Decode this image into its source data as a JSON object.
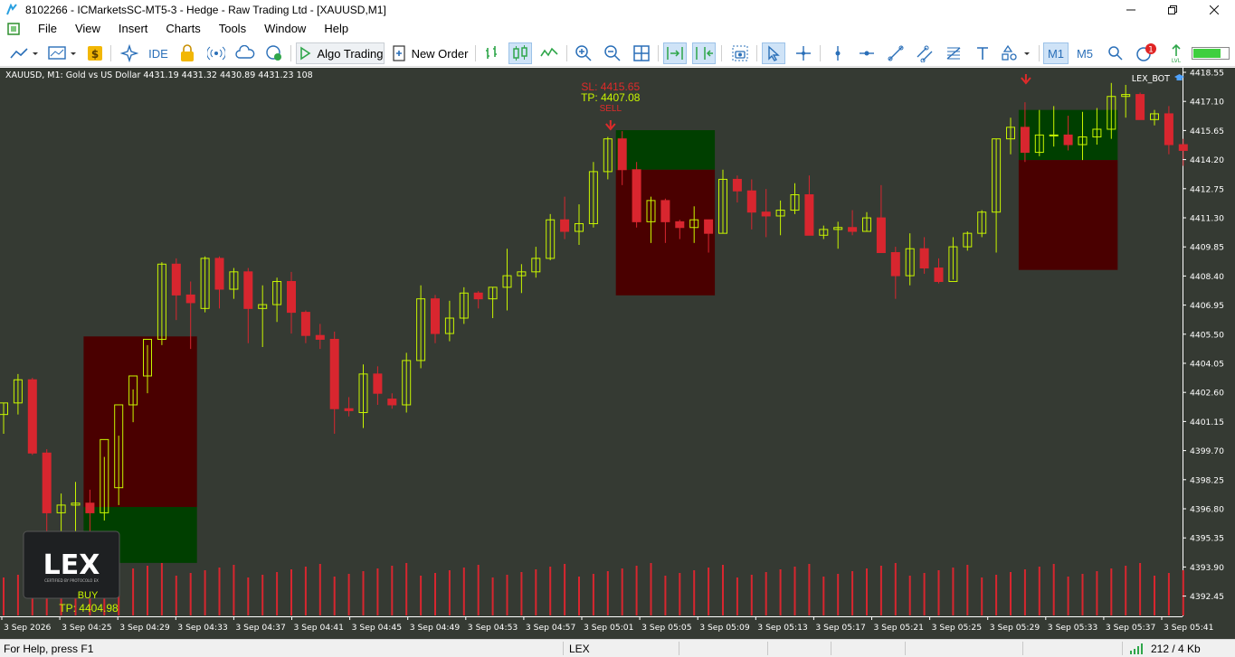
{
  "window": {
    "title": "8102266 - ICMarketsSC-MT5-3 - Hedge - Raw Trading Ltd - [XAUUSD,M1]"
  },
  "menu": [
    "File",
    "View",
    "Insert",
    "Charts",
    "Tools",
    "Window",
    "Help"
  ],
  "toolbar": {
    "ide_label": "IDE",
    "algo_trading_label": "Algo Trading",
    "new_order_label": "New Order",
    "timeframe_m1": "M1",
    "timeframe_m5": "M5",
    "notification_count": "1"
  },
  "chart": {
    "symbol_info": "XAUUSD, M1:  Gold vs US Dollar  4431.19 4431.32 4430.89 4431.23  108",
    "ea_name": "LEX_BOT",
    "logo_text": "LEX",
    "logo_subtitle": "CERTIFIED BY PROTOCOLO EX",
    "signals": {
      "sell_sl": "SL: 4415.65",
      "sell_tp": "TP: 4407.08",
      "sell_label": "SELL",
      "buy_label": "BUY",
      "buy_tp": "TP: 4404.98"
    },
    "price_axis": [
      "4418.55",
      "4417.10",
      "4415.65",
      "4414.20",
      "4412.75",
      "4411.30",
      "4409.85",
      "4408.40",
      "4406.95",
      "4405.50",
      "4404.05",
      "4402.60",
      "4401.15",
      "4399.70",
      "4398.25",
      "4396.80",
      "4395.35",
      "4393.90",
      "4392.45"
    ],
    "time_axis": [
      "3 Sep 2026",
      "3 Sep 04:25",
      "3 Sep 04:29",
      "3 Sep 04:33",
      "3 Sep 04:37",
      "3 Sep 04:41",
      "3 Sep 04:45",
      "3 Sep 04:49",
      "3 Sep 04:53",
      "3 Sep 04:57",
      "3 Sep 05:01",
      "3 Sep 05:05",
      "3 Sep 05:09",
      "3 Sep 05:13",
      "3 Sep 05:17",
      "3 Sep 05:21",
      "3 Sep 05:25",
      "3 Sep 05:29",
      "3 Sep 05:33",
      "3 Sep 05:37",
      "3 Sep 05:41"
    ],
    "colors": {
      "background": "#353a33",
      "bull": "#c8f500",
      "bear": "#d8262f",
      "sl_zone": "#4a0000",
      "tp_zone": "#003f00",
      "volume": "#d8262f"
    }
  },
  "chart_data": {
    "type": "candlestick",
    "y_range": [
      4391.6,
      4418.7
    ],
    "candles": [
      [
        4400.9,
        4401.5,
        4399.9,
        4401.5
      ],
      [
        4401.5,
        4403.0,
        4400.9,
        4402.7
      ],
      [
        4402.7,
        4402.8,
        4398.8,
        4398.9
      ],
      [
        4398.9,
        4399.1,
        4394.1,
        4395.8
      ],
      [
        4395.8,
        4396.8,
        4394.6,
        4396.2
      ],
      [
        4396.2,
        4397.4,
        4393.3,
        4396.3
      ],
      [
        4396.3,
        4397.0,
        4394.2,
        4395.8
      ],
      [
        4395.8,
        4398.7,
        4395.4,
        4399.6
      ],
      [
        4397.1,
        4399.8,
        4396.2,
        4401.4
      ],
      [
        4401.4,
        4402.2,
        4400.5,
        4402.9
      ],
      [
        4402.9,
        4404.5,
        4402.0,
        4404.8
      ],
      [
        4404.8,
        4408.8,
        4404.5,
        4408.7
      ],
      [
        4408.7,
        4409.0,
        4405.8,
        4407.1
      ],
      [
        4407.1,
        4407.8,
        4404.3,
        4406.7
      ],
      [
        4406.4,
        4409.1,
        4406.2,
        4409.0
      ],
      [
        4409.0,
        4409.1,
        4406.4,
        4407.4
      ],
      [
        4407.4,
        4408.5,
        4406.9,
        4408.3
      ],
      [
        4408.3,
        4408.5,
        4404.6,
        4406.4
      ],
      [
        4406.4,
        4407.6,
        4404.4,
        4406.6
      ],
      [
        4406.6,
        4408.0,
        4405.7,
        4407.8
      ],
      [
        4407.8,
        4408.3,
        4405.1,
        4406.2
      ],
      [
        4406.2,
        4406.3,
        4404.6,
        4405.0
      ],
      [
        4405.0,
        4405.6,
        4404.3,
        4404.8
      ],
      [
        4404.8,
        4405.2,
        4399.9,
        4401.2
      ],
      [
        4401.2,
        4401.8,
        4400.8,
        4401.1
      ],
      [
        4401.0,
        4403.5,
        4400.2,
        4403.0
      ],
      [
        4403.0,
        4403.4,
        4401.4,
        4402.0
      ],
      [
        4401.7,
        4402.0,
        4401.2,
        4401.4
      ],
      [
        4401.4,
        4404.1,
        4401.0,
        4403.7
      ],
      [
        4403.7,
        4407.6,
        4403.3,
        4406.9
      ],
      [
        4406.9,
        4407.1,
        4404.6,
        4405.1
      ],
      [
        4405.1,
        4406.8,
        4404.7,
        4405.9
      ],
      [
        4405.9,
        4407.5,
        4405.6,
        4407.2
      ],
      [
        4407.2,
        4407.3,
        4406.4,
        4406.9
      ],
      [
        4406.9,
        4407.5,
        4405.9,
        4407.5
      ],
      [
        4407.5,
        4409.5,
        4406.3,
        4408.1
      ],
      [
        4408.1,
        4408.7,
        4407.2,
        4408.3
      ],
      [
        4408.3,
        4409.6,
        4408.0,
        4409.0
      ],
      [
        4409.0,
        4411.3,
        4408.9,
        4411.0
      ],
      [
        4411.0,
        4412.2,
        4410.0,
        4410.4
      ],
      [
        4410.4,
        4411.8,
        4409.7,
        4410.8
      ],
      [
        4410.8,
        4414.0,
        4410.6,
        4413.5
      ],
      [
        4413.5,
        4415.3,
        4413.1,
        4415.2
      ],
      [
        4415.2,
        4415.6,
        4412.8,
        4413.6
      ],
      [
        4413.6,
        4414.0,
        4410.6,
        4410.9
      ],
      [
        4410.9,
        4412.2,
        4409.8,
        4412.0
      ],
      [
        4412.0,
        4412.1,
        4409.8,
        4410.9
      ],
      [
        4410.9,
        4411.0,
        4410.0,
        4410.6
      ],
      [
        4410.6,
        4411.7,
        4409.8,
        4411.0
      ],
      [
        4411.0,
        4411.0,
        4409.3,
        4410.3
      ],
      [
        4410.3,
        4413.6,
        4410.3,
        4413.1
      ],
      [
        4413.1,
        4413.3,
        4411.9,
        4412.5
      ],
      [
        4412.5,
        4413.1,
        4410.5,
        4411.4
      ],
      [
        4411.4,
        4412.6,
        4410.1,
        4411.2
      ],
      [
        4411.2,
        4412.0,
        4410.2,
        4411.5
      ],
      [
        4411.5,
        4412.9,
        4411.3,
        4412.3
      ],
      [
        4412.3,
        4413.3,
        4410.7,
        4410.2
      ],
      [
        4410.2,
        4410.7,
        4410.0,
        4410.5
      ],
      [
        4410.5,
        4410.9,
        4409.5,
        4410.6
      ],
      [
        4410.6,
        4411.5,
        4410.2,
        4410.4
      ],
      [
        4410.4,
        4411.4,
        4410.4,
        4411.1
      ],
      [
        4411.1,
        4412.8,
        4409.6,
        4409.3
      ],
      [
        4409.3,
        4409.6,
        4406.9,
        4408.1
      ],
      [
        4408.1,
        4410.3,
        4407.6,
        4409.5
      ],
      [
        4409.5,
        4410.1,
        4408.2,
        4408.5
      ],
      [
        4408.5,
        4409.0,
        4407.7,
        4407.8
      ],
      [
        4407.8,
        4410.1,
        4407.9,
        4409.6
      ],
      [
        4409.6,
        4410.4,
        4409.4,
        4410.3
      ],
      [
        4410.3,
        4411.5,
        4410.1,
        4411.4
      ],
      [
        4411.4,
        4415.2,
        4409.3,
        4415.2
      ],
      [
        4415.2,
        4416.3,
        4414.4,
        4415.8
      ],
      [
        4415.8,
        4417.1,
        4414.0,
        4414.5
      ],
      [
        4414.5,
        4416.7,
        4414.3,
        4415.4
      ],
      [
        4415.4,
        4416.9,
        4414.8,
        4415.4
      ],
      [
        4415.4,
        4416.4,
        4414.6,
        4414.9
      ],
      [
        4414.9,
        4416.6,
        4414.1,
        4415.3
      ],
      [
        4415.3,
        4416.8,
        4414.9,
        4415.7
      ],
      [
        4415.7,
        4418.1,
        4415.2,
        4417.4
      ],
      [
        4417.4,
        4418.0,
        4416.3,
        4417.5
      ],
      [
        4417.5,
        4417.6,
        4416.3,
        4416.2
      ],
      [
        4416.2,
        4416.7,
        4415.9,
        4416.5
      ],
      [
        4416.5,
        4416.9,
        4414.4,
        4414.9
      ],
      [
        4414.9,
        4415.2,
        4413.8,
        4414.6
      ]
    ],
    "buy_trade": {
      "entry": 4396.1,
      "sl": 4404.95,
      "tp": 4393.2
    },
    "sell_trade": {
      "entry": 4413.6,
      "sl": 4415.65,
      "tp": 4407.08
    },
    "last_trade": {
      "entry": 4414.1,
      "sl": 4416.7,
      "tp": 4408.4
    }
  },
  "status": {
    "help": "For Help, press F1",
    "profile": "LEX",
    "traffic": "212 / 4 Kb"
  }
}
